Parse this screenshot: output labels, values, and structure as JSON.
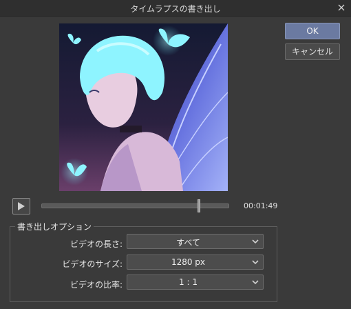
{
  "dialog": {
    "title": "タイムラプスの書き出し"
  },
  "buttons": {
    "ok": "OK",
    "cancel": "キャンセル"
  },
  "playback": {
    "time": "00:01:49",
    "progress": 0.84
  },
  "options": {
    "group_title": "書き出しオプション",
    "rows": [
      {
        "label": "ビデオの長さ:",
        "value": "すべて"
      },
      {
        "label": "ビデオのサイズ:",
        "value": "1280 px"
      },
      {
        "label": "ビデオの比率:",
        "value": "1 : 1"
      }
    ]
  },
  "icons": {
    "close": "close-icon",
    "play": "play-icon",
    "dropdown": "chevron-down-icon"
  },
  "colors": {
    "primary_button": "#6b7aa1",
    "background": "#3a3a3a"
  }
}
